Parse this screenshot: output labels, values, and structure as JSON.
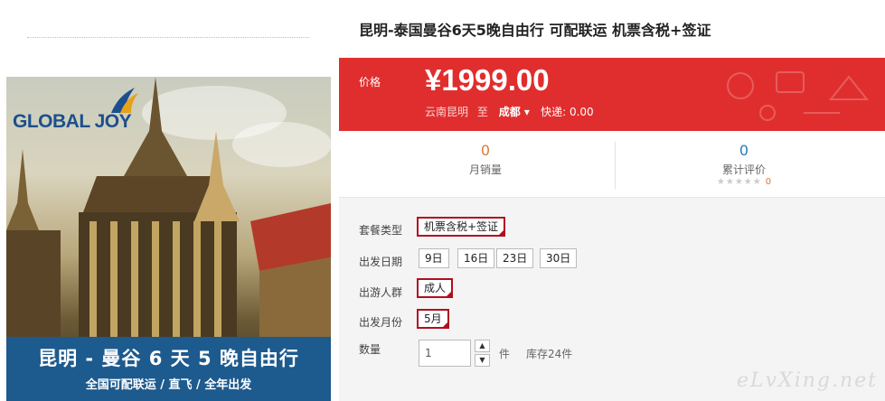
{
  "product": {
    "title": "昆明-泰国曼谷6天5晚自由行 可配联运 机票含税+签证"
  },
  "image": {
    "logo_text": "GLOBAL JOY",
    "banner_title": "昆明 - 曼谷 6 天 5 晚自由行",
    "banner_subtitle": "全国可配联运 / 直飞 / 全年出发"
  },
  "price": {
    "label": "价格",
    "value": "¥1999.00",
    "origin": "云南昆明",
    "to": "至",
    "destination": "成都",
    "destination_arrow": "▾",
    "express": "快递: 0.00"
  },
  "stats": {
    "monthly_sales_count": "0",
    "monthly_sales_label": "月销量",
    "reviews_count": "0",
    "reviews_label": "累计评价",
    "stars": "★★★★★",
    "stars_count": "0"
  },
  "options": {
    "package_label": "套餐类型",
    "package_value": "机票含税+签证",
    "date_label": "出发日期",
    "dates": [
      "9日",
      "16日",
      "23日",
      "30日"
    ],
    "group_label": "出游人群",
    "group_value": "成人",
    "month_label": "出发月份",
    "month_value": "5月",
    "qty_label": "数量",
    "qty_value": "1",
    "qty_unit": "件",
    "stock": "库存24件",
    "qty_up": "▲",
    "qty_down": "▼"
  },
  "watermark": "eLvXing.net",
  "colors": {
    "price_band": "#e02e2e",
    "selected_border": "#b10e1e",
    "banner": "#1d5a8e",
    "stat_blue": "#2a7ab8",
    "stat_orange": "#d97a3b"
  }
}
